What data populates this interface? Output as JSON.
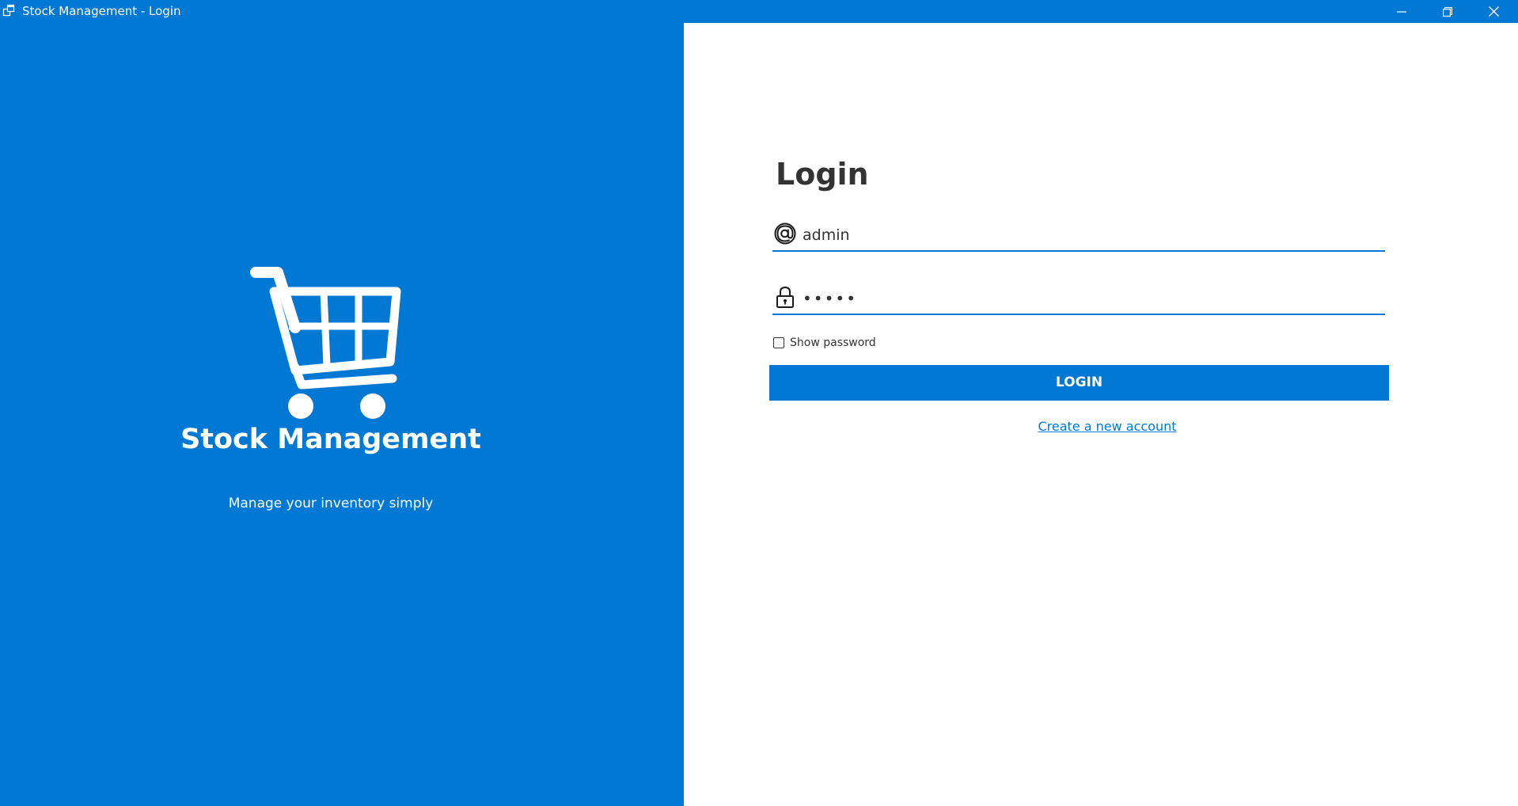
{
  "window": {
    "title": "Stock Management - Login",
    "accent_color": "#0078d4"
  },
  "titlebar_buttons": {
    "minimize_icon": "minimize-icon",
    "maximize_icon": "restore-icon",
    "close_icon": "close-icon"
  },
  "brand": {
    "icon": "shopping-cart-icon",
    "title": "Stock Management",
    "subtitle": "Manage your inventory simply"
  },
  "login": {
    "heading": "Login",
    "username": {
      "icon": "at-sign-icon",
      "value": "admin"
    },
    "password": {
      "icon": "lock-icon",
      "value": "•••••"
    },
    "show_password_label": "Show password",
    "show_password_checked": false,
    "login_button_label": "LOGIN",
    "create_account_link": "Create a new account"
  }
}
